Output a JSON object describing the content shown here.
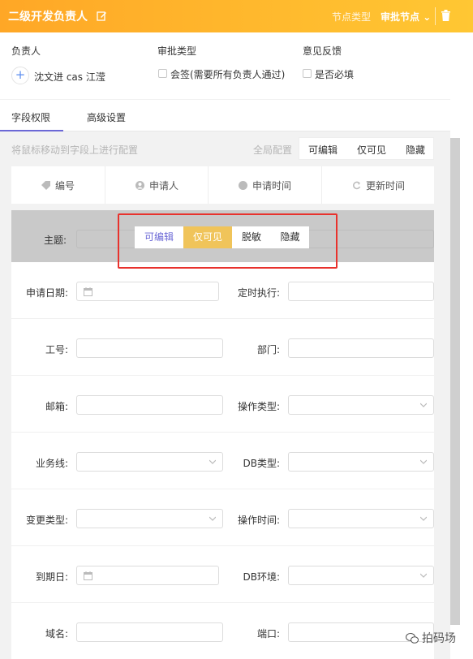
{
  "header": {
    "title": "二级开发负责人",
    "node_type_label": "节点类型",
    "node_type_value": "审批节点"
  },
  "info": {
    "owner_label": "负责人",
    "owner_name": "沈文进 cas 江滢",
    "approval_label": "审批类型",
    "approval_option": "会签(需要所有负责人通过)",
    "feedback_label": "意见反馈",
    "feedback_option": "是否必填"
  },
  "tabs": [
    {
      "label": "字段权限",
      "active": true
    },
    {
      "label": "高级设置",
      "active": false
    }
  ],
  "toolbar": {
    "hint": "将鼠标移动到字段上进行配置",
    "global_label": "全局配置",
    "global_options": [
      "可编辑",
      "仅可见",
      "隐藏"
    ]
  },
  "meta_fields": [
    {
      "label": "编号",
      "icon": "tag-icon"
    },
    {
      "label": "申请人",
      "icon": "user-icon"
    },
    {
      "label": "申请时间",
      "icon": "clock-icon"
    },
    {
      "label": "更新时间",
      "icon": "refresh-icon"
    }
  ],
  "subject": {
    "label": "主题:",
    "options": [
      "可编辑",
      "仅可见",
      "脱敏",
      "隐藏"
    ],
    "selected": "仅可见"
  },
  "form_rows": [
    {
      "left": {
        "label": "申请日期:",
        "type": "date"
      },
      "right": {
        "label": "定时执行:",
        "type": "text"
      }
    },
    {
      "left": {
        "label": "工号:",
        "type": "text"
      },
      "right": {
        "label": "部门:",
        "type": "text"
      }
    },
    {
      "left": {
        "label": "邮箱:",
        "type": "text"
      },
      "right": {
        "label": "操作类型:",
        "type": "select"
      }
    },
    {
      "left": {
        "label": "业务线:",
        "type": "select"
      },
      "right": {
        "label": "DB类型:",
        "type": "select"
      }
    },
    {
      "left": {
        "label": "变更类型:",
        "type": "select"
      },
      "right": {
        "label": "操作时间:",
        "type": "select"
      }
    },
    {
      "left": {
        "label": "到期日:",
        "type": "date"
      },
      "right": {
        "label": "DB环境:",
        "type": "select"
      }
    },
    {
      "left": {
        "label": "域名:",
        "type": "text"
      },
      "right": {
        "label": "端口:",
        "type": "text"
      }
    }
  ],
  "watermark": "拍码场",
  "colors": {
    "header_start": "#ffa726",
    "header_end": "#ffc733",
    "accent": "#6b68d6",
    "selected": "#f0c45a",
    "highlight_border": "#e8322d"
  }
}
